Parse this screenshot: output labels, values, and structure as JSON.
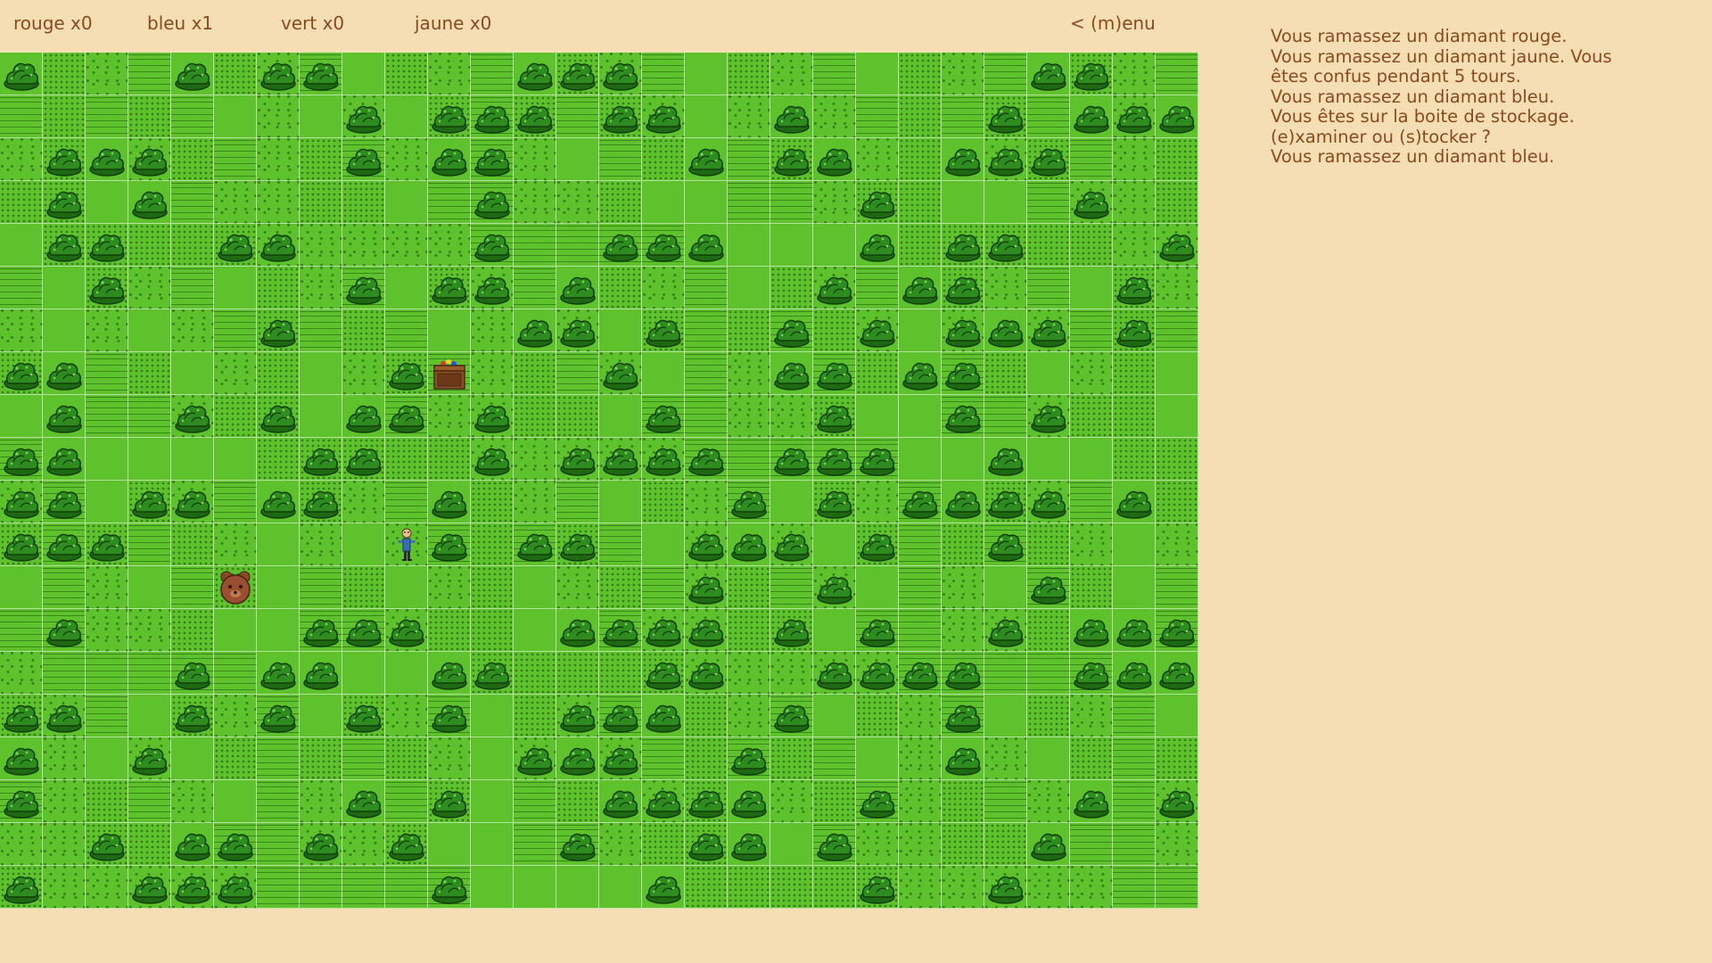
{
  "hud": {
    "items": [
      {
        "label": "rouge x0"
      },
      {
        "label": "bleu x1"
      },
      {
        "label": "vert x0"
      },
      {
        "label": "jaune x0"
      }
    ],
    "menu_label": "< (m)enu"
  },
  "colors": {
    "background": "#f5deb3",
    "text": "#8b4a1e",
    "grass": "#5ec22c",
    "bush": "#2e8b1e"
  },
  "map": {
    "rows": [
      "BdpdBpBBdddpBBBd.dppddd.BBd",
      "dpdp..pdBdBBBdBBdpBd..pB.BBB",
      "dBBBddd.BdBBddd.B.BBdpBBBdd",
      ".B.Bpdbbbb.B.p..d.d.Bpd.dBp",
      "dBB..BBddd.Bd.BBB..pB.BBdpdBd",
      "ddB.dp.pB.BBdBddd.dB.BBd.pBd",
      "...dd.B.d..dBB.B.dB.B.BBBdB",
      "BB.ddd..pB[..dBdp.BBpBB..dddd.",
      "pB.pBdB.BB.Bpd.B.dpB..BpBdpd",
      "BBddddpBBddBdBBBB.BBB.pBdd.d",
      "BB.BB.BBd.B.dddd.B.B.BBBBdBdB",
      "BBBd.dddd@B.BBd.BBBdBd.B..d.B",
      ".ddd.cdd.dd.pdd.B.dB.dd.Bddd",
      ".Bd.p.dBBBdd.BBBB.BdBdpBpBBBB",
      ".dd.BpBBd.BBd..BB.pBBBBddBBBdp",
      "BBpdBdBpB.Bd.BBBd.Bd.pBp..dd",
      "B..Bddddd.dpBBBd.Bdpd.Bpd..d",
      "Bppd..dpB.Bp.dBBBBd.Bd.ppB.B.",
      ".dBpBBdB.B.dpBp.BB.Bdd.dB.dpd",
      "B.dBBB.pp.B.dpdBdpddB.dBdpddB"
    ]
  },
  "messages": [
    "Vous ramassez un diamant rouge.",
    "Vous ramassez un diamant jaune. Vous",
    "êtes confus pendant 5 tours.",
    "Vous ramassez un diamant bleu.",
    "Vous êtes sur la boite de stockage.",
    "(e)xaminer ou (s)tocker ?",
    "Vous ramassez un diamant bleu."
  ]
}
